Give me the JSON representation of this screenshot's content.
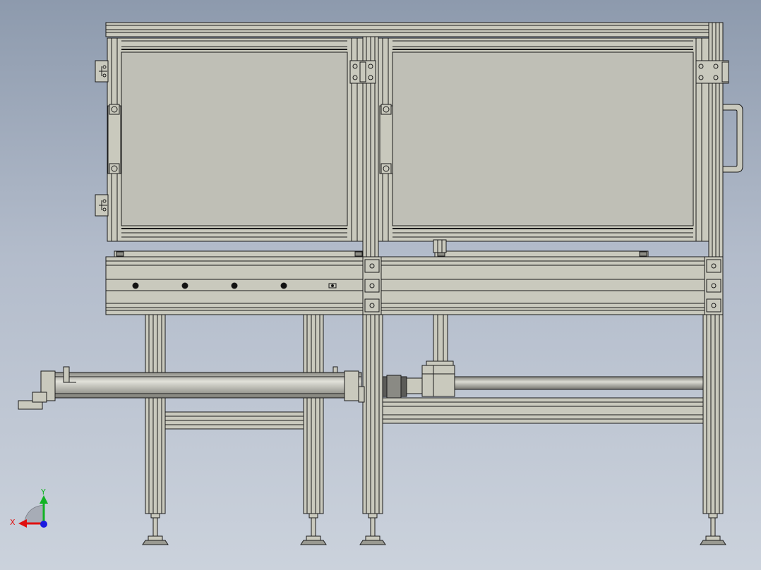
{
  "triad": {
    "x_label": "X",
    "y_label": "Y",
    "x_color": "#e01010",
    "y_color": "#12b324",
    "z_color": "#1a1ae0"
  },
  "colors": {
    "background_top": "#8d9aad",
    "background_bottom": "#cbd2dc",
    "profile_fill": "#c9c9bd",
    "panel_fill": "#bfbfb6",
    "edge": "#1b1b1b"
  }
}
